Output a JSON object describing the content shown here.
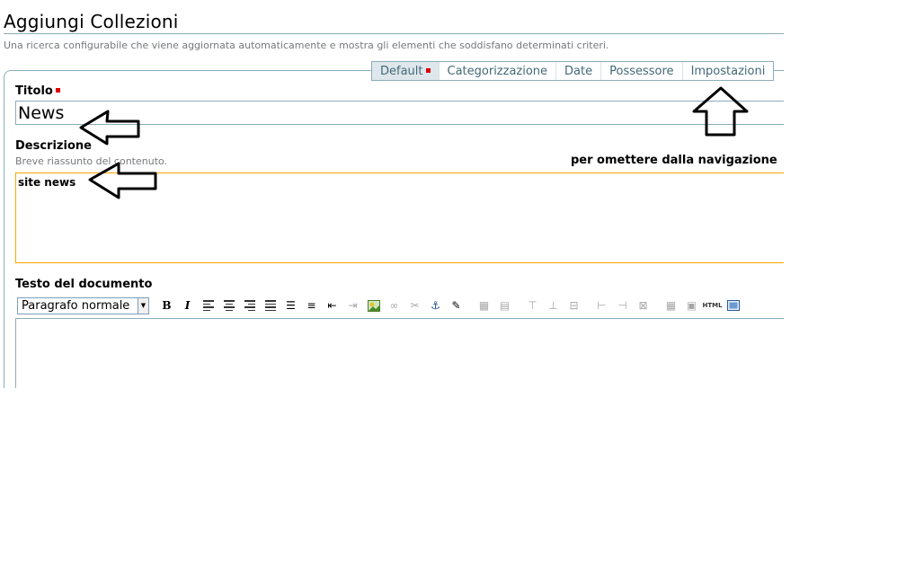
{
  "page": {
    "title": "Aggiungi Collezioni",
    "description": "Una ricerca configurabile che viene aggiornata automaticamente e mostra gli elementi che soddisfano determinati criteri."
  },
  "tabs": [
    {
      "label": "Default",
      "active": true,
      "required": true
    },
    {
      "label": "Categorizzazione"
    },
    {
      "label": "Date"
    },
    {
      "label": "Possessore"
    },
    {
      "label": "Impostazioni"
    }
  ],
  "fields": {
    "titolo": {
      "label": "Titolo",
      "value": "News",
      "required": true
    },
    "descrizione": {
      "label": "Descrizione",
      "help": "Breve riassunto del contenuto.",
      "value": "site news"
    },
    "testo": {
      "label": "Testo del documento"
    }
  },
  "editor_toolbar": {
    "format_select": "Paragrafo normale",
    "buttons": [
      "bold-icon",
      "italic-icon",
      "align-left-icon",
      "align-center-icon",
      "align-right-icon",
      "justify-icon",
      "bullet-list-icon",
      "numbered-list-icon",
      "outdent-icon",
      "indent-icon",
      "image-icon",
      "link-icon",
      "unlink-icon",
      "anchor-icon",
      "edit-icon",
      "table-icon",
      "table-merge-icon",
      "insert-row-before-icon",
      "insert-row-after-icon",
      "delete-row-icon",
      "insert-col-before-icon",
      "insert-col-after-icon",
      "delete-col-icon",
      "table-props-icon",
      "cell-props-icon",
      "html-source-icon",
      "fullscreen-icon"
    ],
    "html_label": "HTML"
  },
  "annotation": {
    "text": "per omettere dalla navigazione"
  },
  "colors": {
    "required": "#dd0000",
    "border": "#8cacbb",
    "focus": "#ffa500",
    "tab_text": "#436976"
  }
}
